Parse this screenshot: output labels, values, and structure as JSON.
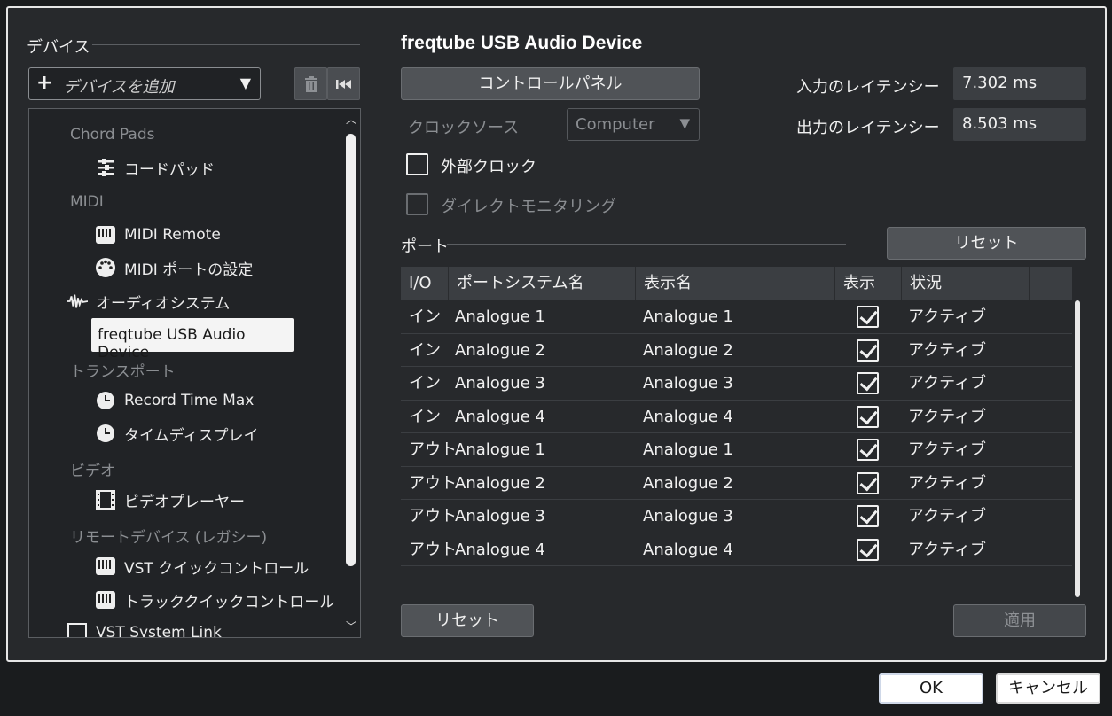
{
  "left": {
    "section_title": "デバイス",
    "add_device": {
      "label": "デバイスを追加",
      "caret": "▼"
    },
    "buttons": {
      "delete_icon": "trash-icon",
      "reset_icon": "skip-back-icon"
    },
    "tree": {
      "cat_chord": "Chord Pads",
      "item_chord": "コードパッド",
      "cat_midi": "MIDI",
      "item_midi_remote": "MIDI Remote",
      "item_midi_port": "MIDI ポートの設定",
      "item_audio_system": "オーディオシステム",
      "item_selected": "freqtube USB Audio Device",
      "cat_transport": "トランスポート",
      "item_record_time": "Record Time Max",
      "item_time_display": "タイムディスプレイ",
      "cat_video": "ビデオ",
      "item_video_player": "ビデオプレーヤー",
      "cat_remote": "リモートデバイス (レガシー)",
      "item_vst_quick": "VST クイックコントロール",
      "item_track_quick": "トラッククイックコントロール",
      "item_vst_system_link": "VST System Link"
    }
  },
  "right": {
    "title": "freqtube USB Audio Device",
    "control_panel": "コントロールパネル",
    "clock_source_label": "クロックソース",
    "clock_source_value": "Computer",
    "caret": "▼",
    "input_latency_label": "入力のレイテンシー",
    "input_latency_value": "7.302 ms",
    "output_latency_label": "出力のレイテンシー",
    "output_latency_value": "8.503 ms",
    "external_clock": "外部クロック",
    "direct_monitoring": "ダイレクトモニタリング",
    "ports_title": "ポート",
    "reset_top": "リセット",
    "reset_bottom": "リセット",
    "apply": "適用"
  },
  "table": {
    "headers": {
      "io": "I/O",
      "port_name": "ポートシステム名",
      "display_name": "表示名",
      "show": "表示",
      "status": "状況"
    },
    "rows": [
      {
        "io": "イン",
        "port": "Analogue 1",
        "display": "Analogue 1",
        "status": "アクティブ"
      },
      {
        "io": "イン",
        "port": "Analogue 2",
        "display": "Analogue 2",
        "status": "アクティブ"
      },
      {
        "io": "イン",
        "port": "Analogue 3",
        "display": "Analogue 3",
        "status": "アクティブ"
      },
      {
        "io": "イン",
        "port": "Analogue 4",
        "display": "Analogue 4",
        "status": "アクティブ"
      },
      {
        "io": "アウト",
        "port": "Analogue 1",
        "display": "Analogue 1",
        "status": "アクティブ"
      },
      {
        "io": "アウト",
        "port": "Analogue 2",
        "display": "Analogue 2",
        "status": "アクティブ"
      },
      {
        "io": "アウト",
        "port": "Analogue 3",
        "display": "Analogue 3",
        "status": "アクティブ"
      },
      {
        "io": "アウト",
        "port": "Analogue 4",
        "display": "Analogue 4",
        "status": "アクティブ"
      }
    ]
  },
  "dialog": {
    "ok": "OK",
    "cancel": "キャンセル"
  }
}
